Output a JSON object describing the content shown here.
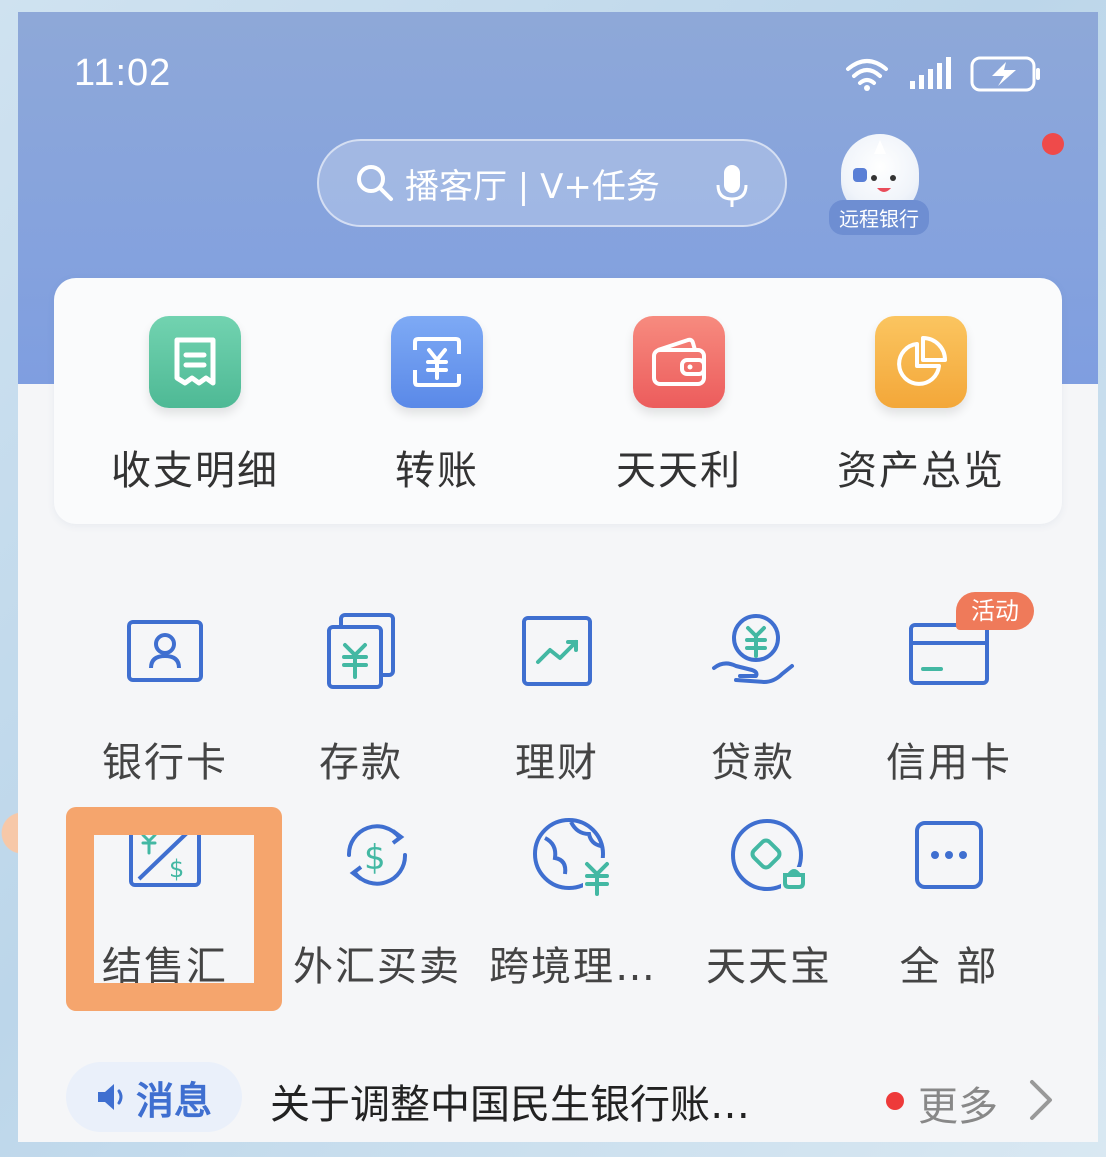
{
  "status_bar": {
    "time": "11:02"
  },
  "top_bar": {
    "search_placeholder": "播客厅 | V+任务",
    "remote_bank_label": "远程银行"
  },
  "quick_actions": [
    {
      "label": "收支明细",
      "icon": "receipt-icon",
      "color": "#5ec5a2"
    },
    {
      "label": "转账",
      "icon": "transfer-yuan-icon",
      "color": "#6a9bf0"
    },
    {
      "label": "天天利",
      "icon": "wallet-icon",
      "color": "#f2706a"
    },
    {
      "label": "资产总览",
      "icon": "pie-chart-icon",
      "color": "#f7b547"
    }
  ],
  "services": [
    {
      "label": "银行卡",
      "icon": "bank-card-icon"
    },
    {
      "label": "存款",
      "icon": "deposit-icon"
    },
    {
      "label": "理财",
      "icon": "wealth-chart-icon"
    },
    {
      "label": "贷款",
      "icon": "loan-icon"
    },
    {
      "label": "信用卡",
      "icon": "credit-card-icon",
      "badge": "活动"
    },
    {
      "label": "结售汇",
      "icon": "exchange-settlement-icon"
    },
    {
      "label": "外汇买卖",
      "icon": "forex-icon"
    },
    {
      "label": "跨境理…",
      "icon": "globe-yuan-icon"
    },
    {
      "label": "天天宝",
      "icon": "tiantianbao-icon"
    },
    {
      "label": "全 部",
      "icon": "more-icon"
    }
  ],
  "news": {
    "tag": "消息",
    "text": "关于调整中国民生银行账…",
    "more": "更多"
  },
  "colors": {
    "header_blue": "#86a3dd",
    "icon_blue": "#3f6fd0",
    "highlight_orange": "#f5a56d",
    "badge_red": "#ef7a5a"
  }
}
